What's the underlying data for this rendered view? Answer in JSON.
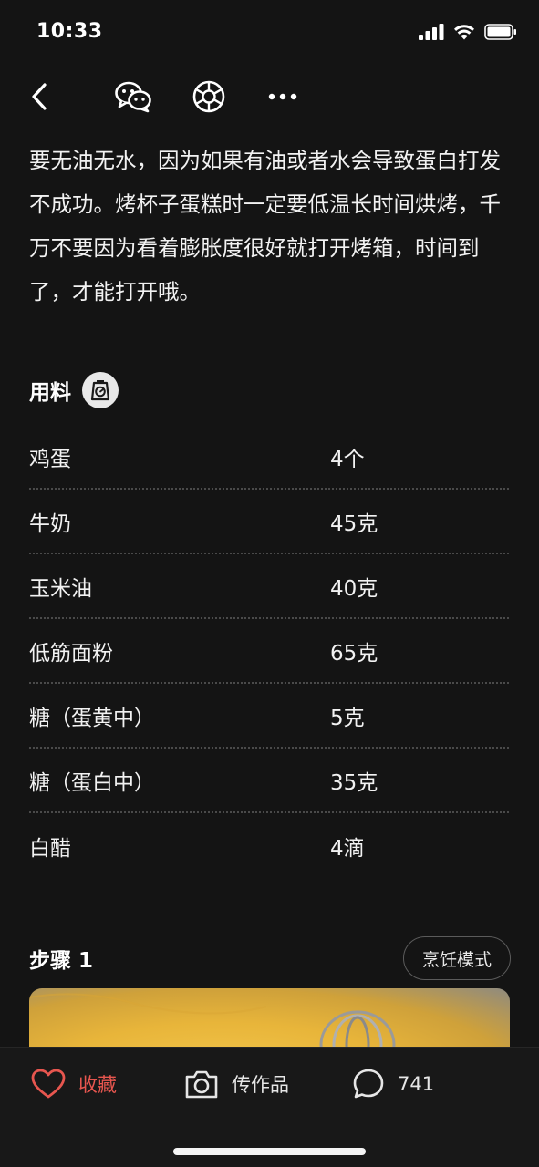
{
  "status": {
    "time": "10:33"
  },
  "nav": {
    "icons": [
      "back-arrow-icon",
      "wechat-icon",
      "moments-icon",
      "more-icon"
    ]
  },
  "intro": "要无油无水，因为如果有油或者水会导致蛋白打发不成功。烤杯子蛋糕时一定要低温长时间烘烤，千万不要因为看着膨胀度很好就打开烤箱，时间到了，才能打开哦。",
  "ingredients": {
    "title": "用料",
    "items": [
      {
        "name": "鸡蛋",
        "amount": "4个"
      },
      {
        "name": "牛奶",
        "amount": "45克"
      },
      {
        "name": "玉米油",
        "amount": "40克"
      },
      {
        "name": "低筋面粉",
        "amount": "65克"
      },
      {
        "name": "糖（蛋黄中）",
        "amount": "5克"
      },
      {
        "name": "糖（蛋白中）",
        "amount": "35克"
      },
      {
        "name": "白醋",
        "amount": "4滴"
      }
    ]
  },
  "step": {
    "title": "步骤 1",
    "cook_mode": "烹饪模式"
  },
  "bottom": {
    "favorite": "收藏",
    "upload": "传作品",
    "comments": "741"
  },
  "colors": {
    "background": "#141414",
    "accent": "#e7564f",
    "divider": "#4a4a4a"
  }
}
